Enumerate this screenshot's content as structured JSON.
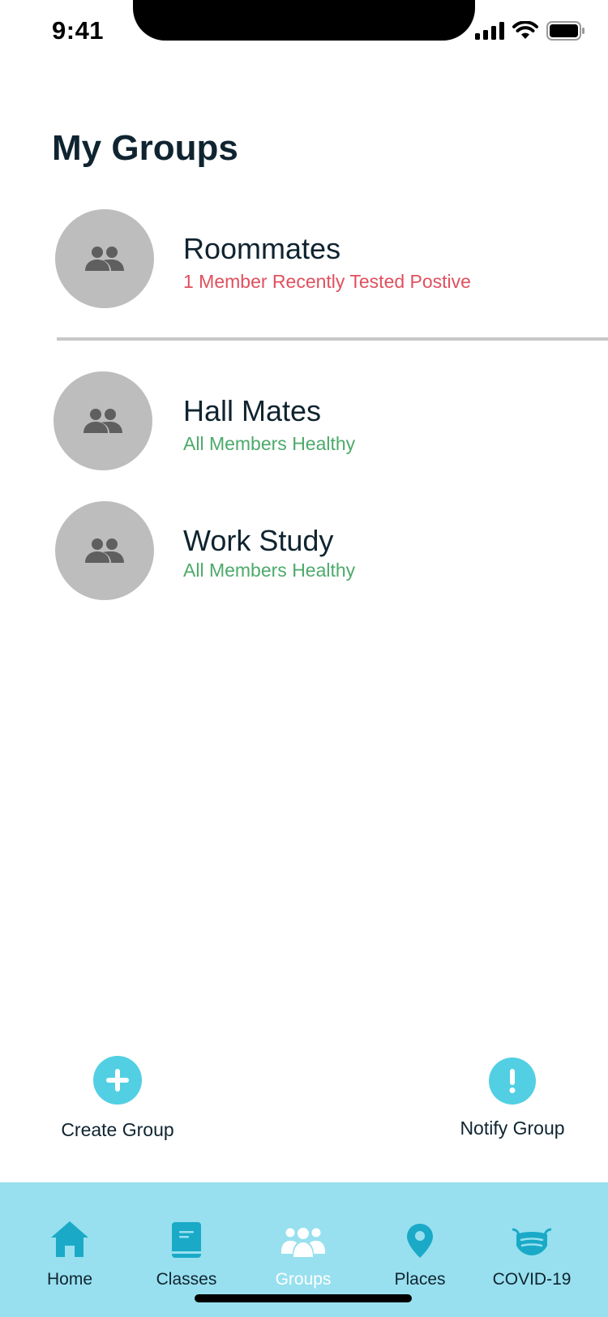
{
  "status_bar": {
    "time": "9:41"
  },
  "header": {
    "title": "My Groups"
  },
  "groups": [
    {
      "name": "Roommates",
      "status": "1 Member Recently Tested Postive",
      "status_type": "alert"
    },
    {
      "name": "Hall Mates",
      "status": "All Members Healthy",
      "status_type": "ok"
    },
    {
      "name": "Work Study",
      "status": "All Members Healthy",
      "status_type": "ok"
    }
  ],
  "actions": {
    "create": {
      "label": "Create Group",
      "icon": "plus-icon"
    },
    "notify": {
      "label": "Notify Group",
      "icon": "exclamation-icon"
    }
  },
  "tabs": [
    {
      "label": "Home",
      "icon": "home-icon"
    },
    {
      "label": "Classes",
      "icon": "book-icon"
    },
    {
      "label": "Groups",
      "icon": "people-icon",
      "active": true
    },
    {
      "label": "Places",
      "icon": "location-pin-icon"
    },
    {
      "label": "COVID-19",
      "icon": "mask-icon"
    }
  ],
  "colors": {
    "accent": "#52cfe3",
    "tab_bar": "#98e0ef",
    "alert": "#e0505e",
    "healthy": "#4caa6a",
    "avatar": "#bdbdbd"
  }
}
